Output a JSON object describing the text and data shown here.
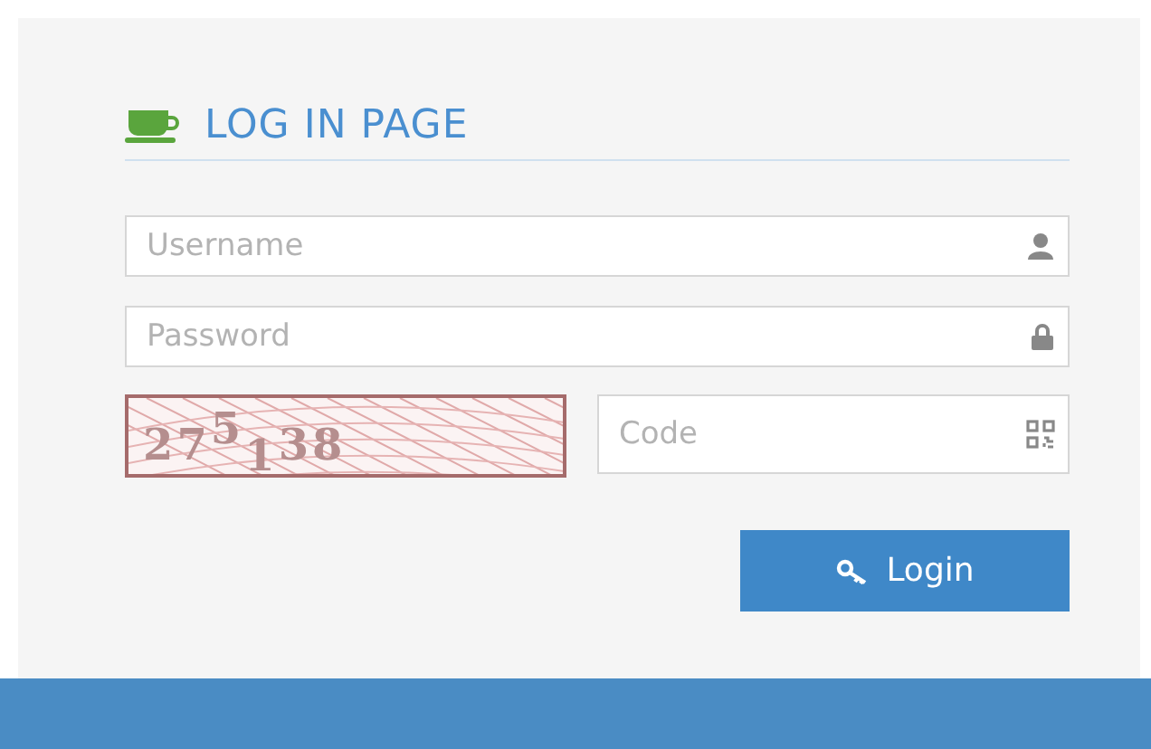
{
  "title": "LOG IN PAGE",
  "fields": [
    {
      "kind": "user",
      "placeholder": "Username"
    },
    {
      "kind": "lock",
      "placeholder": "Password"
    }
  ],
  "captcha": {
    "text": "27$^{5}$$_{1}$38"
  },
  "code_field": {
    "kind": "qr",
    "placeholder": "Code"
  },
  "login_button": {
    "label": "Login"
  }
}
